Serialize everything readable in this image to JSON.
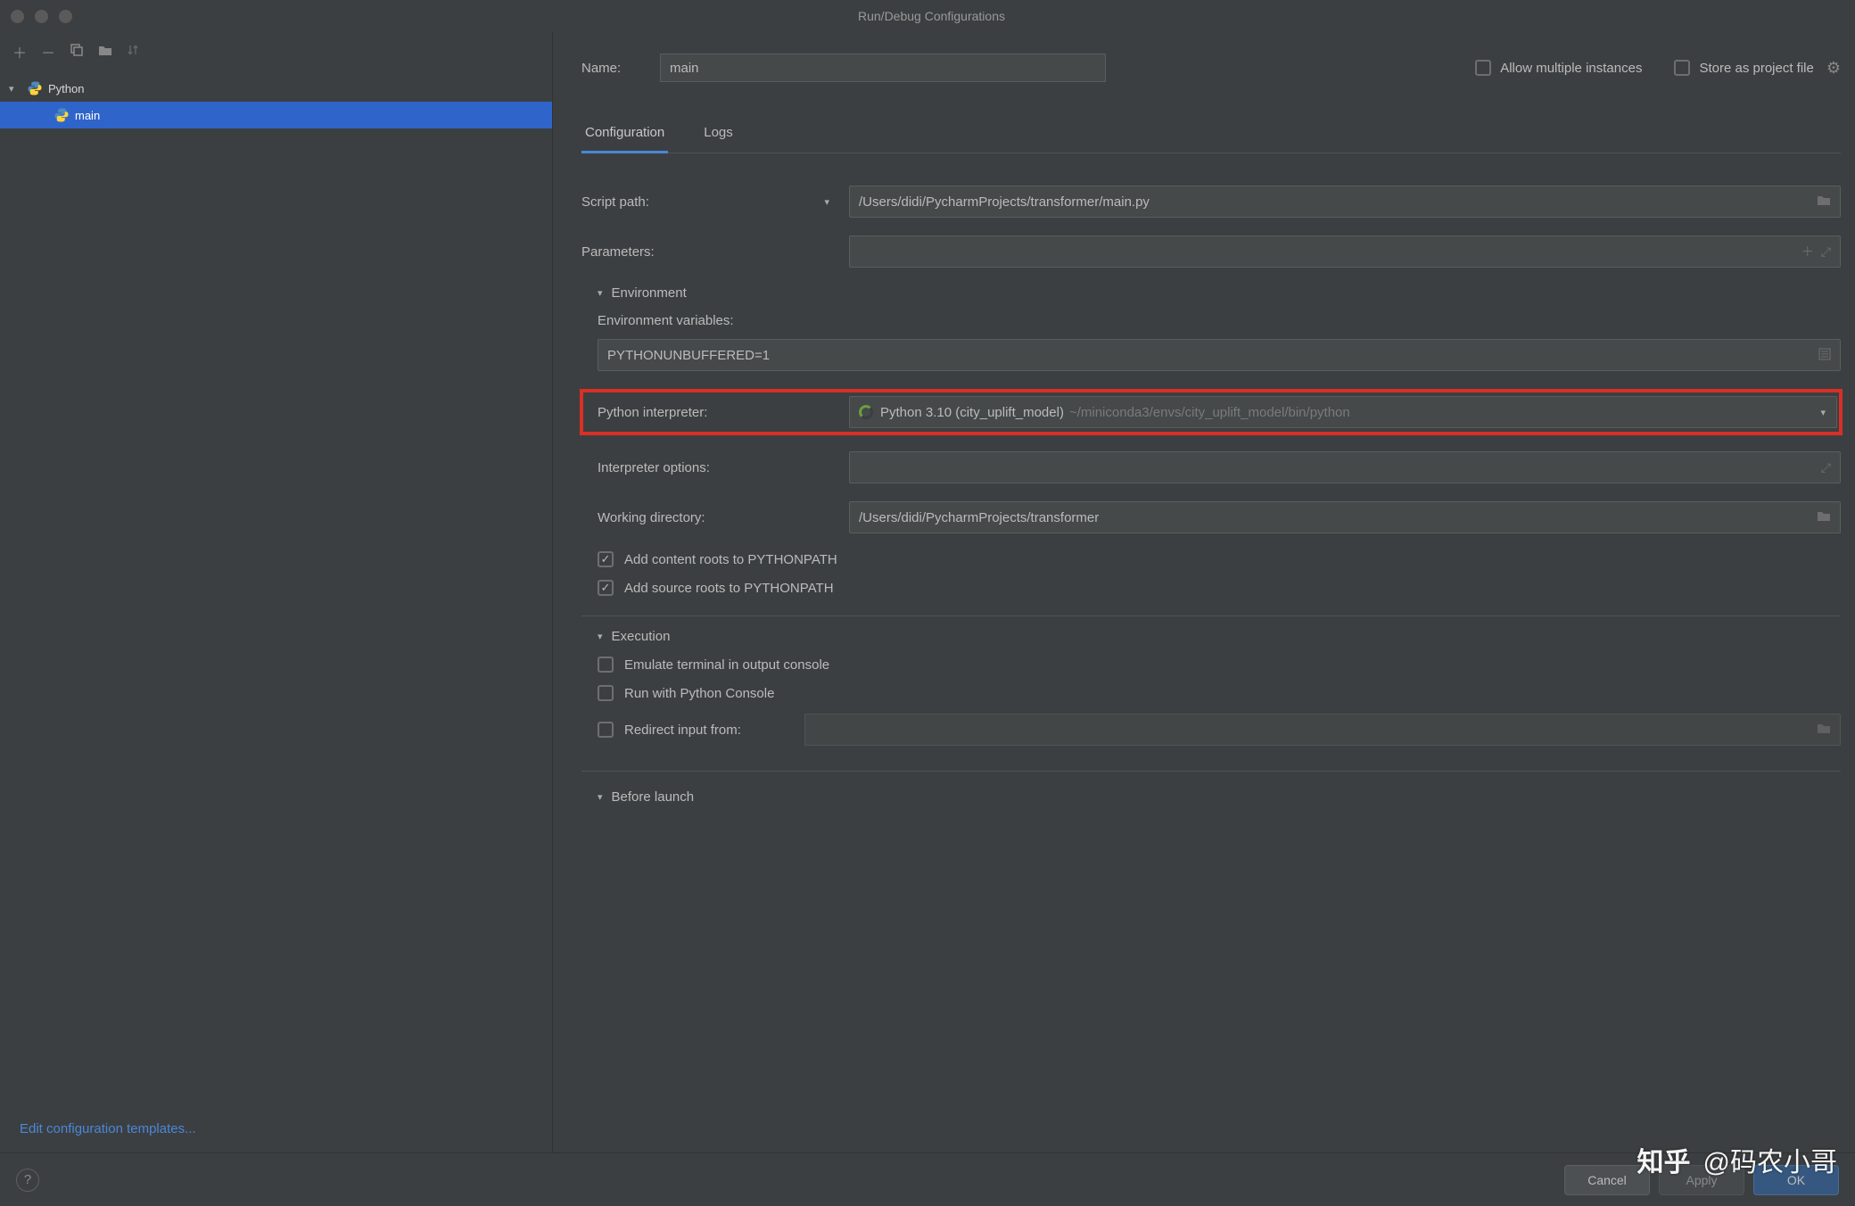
{
  "window": {
    "title": "Run/Debug Configurations"
  },
  "toolbar": {
    "add": "+",
    "remove": "−",
    "copy": "копировать",
    "save": "сохранить",
    "sort": "сортировать"
  },
  "tree": {
    "parent": "Python",
    "child": "main"
  },
  "edit_templates_link": "Edit configuration templates...",
  "form": {
    "name_label": "Name:",
    "name_value": "main",
    "allow_multi_label": "Allow multiple instances",
    "store_label": "Store as project file",
    "tabs": {
      "config": "Configuration",
      "logs": "Logs"
    },
    "script_path_label": "Script path:",
    "script_path_value": "/Users/didi/PycharmProjects/transformer/main.py",
    "parameters_label": "Parameters:",
    "parameters_value": "",
    "env_section": "Environment",
    "env_vars_label": "Environment variables:",
    "env_vars_value": "PYTHONUNBUFFERED=1",
    "interpreter_label": "Python interpreter:",
    "interpreter_main": "Python 3.10 (city_uplift_model)",
    "interpreter_sub": "~/miniconda3/envs/city_uplift_model/bin/python",
    "interp_options_label": "Interpreter options:",
    "interp_options_value": "",
    "workdir_label": "Working directory:",
    "workdir_value": "/Users/didi/PycharmProjects/transformer",
    "add_content_roots": "Add content roots to PYTHONPATH",
    "add_source_roots": "Add source roots to PYTHONPATH",
    "exec_section": "Execution",
    "emulate_terminal": "Emulate terminal in output console",
    "run_python_console": "Run with Python Console",
    "redirect_input": "Redirect input from:",
    "before_launch": "Before launch"
  },
  "footer": {
    "cancel": "Cancel",
    "apply": "Apply",
    "ok": "OK"
  },
  "watermark": "知乎 @码农小哥"
}
